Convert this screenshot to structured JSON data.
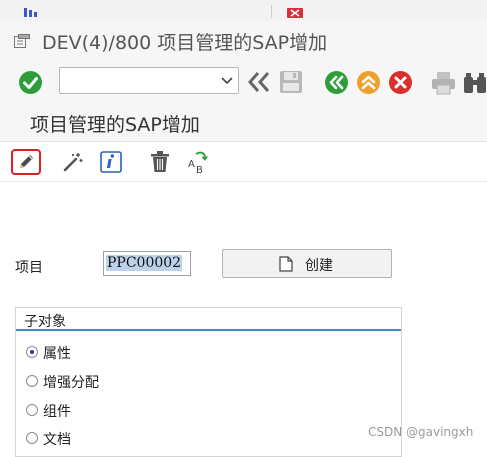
{
  "window": {
    "title": "DEV(4)/800 项目管理的SAP增加"
  },
  "toolbar": {
    "command_field_value": "",
    "buttons": [
      {
        "name": "enter",
        "icon": "green-check-icon"
      },
      {
        "name": "command-dropdown",
        "icon": "chevron-down-icon"
      },
      {
        "name": "collapse",
        "icon": "double-chevron-left-icon"
      },
      {
        "name": "save",
        "icon": "save-icon"
      },
      {
        "name": "back",
        "icon": "back-icon"
      },
      {
        "name": "exit",
        "icon": "exit-icon"
      },
      {
        "name": "cancel",
        "icon": "cancel-icon"
      },
      {
        "name": "print",
        "icon": "print-icon"
      },
      {
        "name": "find",
        "icon": "find-icon"
      }
    ]
  },
  "screen": {
    "title": "项目管理的SAP增加"
  },
  "app_toolbar": {
    "buttons": [
      {
        "name": "edit",
        "icon": "pencil-icon",
        "highlighted": true,
        "highlight_color": "#e0201b"
      },
      {
        "name": "activate",
        "icon": "magic-wand-icon"
      },
      {
        "name": "info",
        "icon": "info-icon"
      },
      {
        "name": "delete",
        "icon": "trash-icon"
      },
      {
        "name": "rename",
        "icon": "rename-icon"
      }
    ]
  },
  "form": {
    "project_label": "项目",
    "project_value": "PPC00002",
    "create_button_label": "创建"
  },
  "subobjects": {
    "title": "子对象",
    "selected_index": 0,
    "options": [
      {
        "label": "属性"
      },
      {
        "label": "增强分配"
      },
      {
        "label": "组件"
      },
      {
        "label": "文档"
      }
    ]
  },
  "watermark": "CSDN @gavingxh",
  "colors": {
    "accent_blue": "#3f8fbf",
    "ok_green": "#2e9e3b",
    "exit_orange": "#f0a02a",
    "cancel_red": "#d8302d",
    "selection_blue": "#bcd2ea"
  }
}
